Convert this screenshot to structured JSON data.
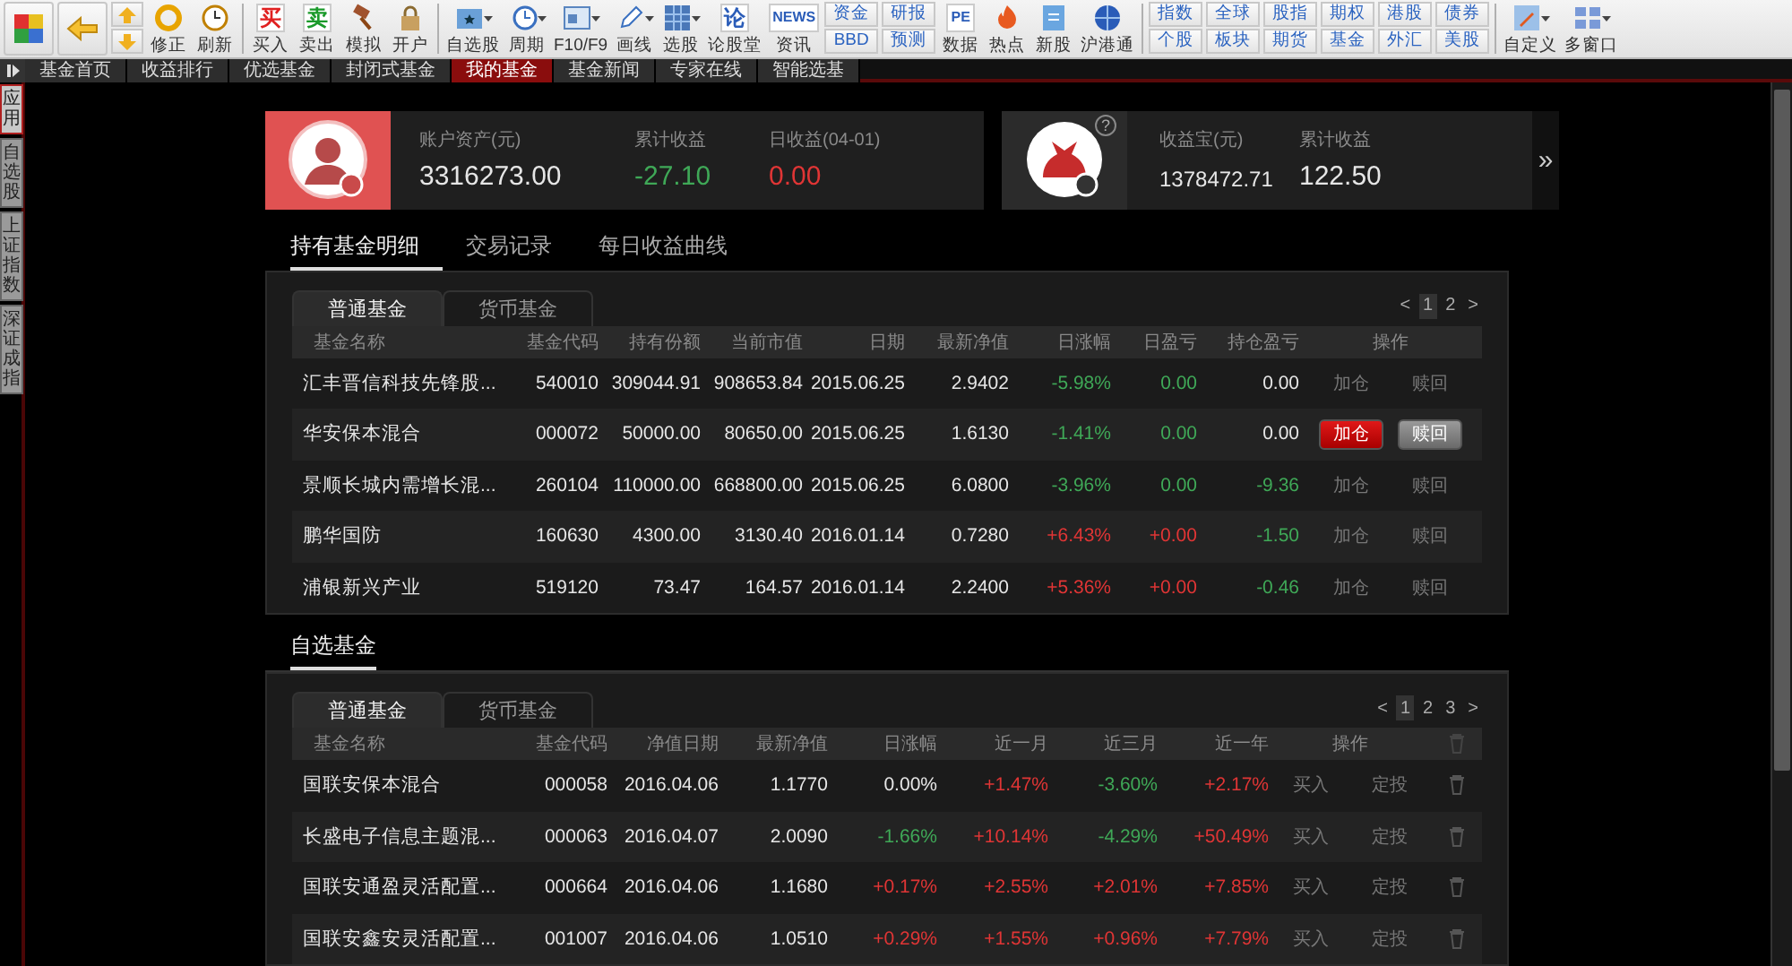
{
  "toolbar": [
    {
      "kind": "tool",
      "label": "修正",
      "dropdown": false
    },
    {
      "kind": "tool",
      "label": "刷新",
      "dropdown": false
    },
    {
      "kind": "separator"
    },
    {
      "kind": "tool",
      "label": "买入",
      "dropdown": false,
      "glyph": "买",
      "color": "#e02020"
    },
    {
      "kind": "tool",
      "label": "卖出",
      "dropdown": false,
      "glyph": "卖",
      "color": "#1a9a2a"
    },
    {
      "kind": "tool",
      "label": "模拟",
      "dropdown": false
    },
    {
      "kind": "tool",
      "label": "开户",
      "dropdown": false
    },
    {
      "kind": "separator"
    },
    {
      "kind": "tool",
      "label": "自选股",
      "dropdown": true
    },
    {
      "kind": "tool",
      "label": "周期",
      "dropdown": true
    },
    {
      "kind": "tool",
      "label": "F10/F9",
      "dropdown": true
    },
    {
      "kind": "tool",
      "label": "画线",
      "dropdown": true
    },
    {
      "kind": "tool",
      "label": "选股",
      "dropdown": true
    },
    {
      "kind": "tool",
      "label": "论股堂",
      "dropdown": false,
      "glyph": "论",
      "color": "#2a5cb8"
    },
    {
      "kind": "tool",
      "label": "资讯",
      "dropdown": false,
      "glyph": "NEWS",
      "color": "#2a5cb8"
    },
    {
      "kind": "pair",
      "top": "资金",
      "bottom": "BBD"
    },
    {
      "kind": "pair",
      "top": "研报",
      "bottom": "预测"
    },
    {
      "kind": "tool",
      "label": "数据",
      "dropdown": false,
      "glyph": "PE",
      "color": "#2a5cb8"
    },
    {
      "kind": "tool",
      "label": "热点",
      "dropdown": false
    },
    {
      "kind": "tool",
      "label": "新股",
      "dropdown": false
    },
    {
      "kind": "tool",
      "label": "沪港通",
      "dropdown": false
    },
    {
      "kind": "separator"
    },
    {
      "kind": "pair",
      "top": "指数",
      "bottom": "个股"
    },
    {
      "kind": "pair",
      "top": "全球",
      "bottom": "板块"
    },
    {
      "kind": "pair",
      "top": "股指",
      "bottom": "期货"
    },
    {
      "kind": "pair",
      "top": "期权",
      "bottom": "基金"
    },
    {
      "kind": "pair",
      "top": "港股",
      "bottom": "外汇"
    },
    {
      "kind": "pair",
      "top": "债券",
      "bottom": "美股"
    },
    {
      "kind": "separator"
    },
    {
      "kind": "tool",
      "label": "自定义",
      "dropdown": true
    },
    {
      "kind": "tool",
      "label": "多窗口",
      "dropdown": true
    }
  ],
  "tabs": [
    {
      "label": "基金首页",
      "selected": false
    },
    {
      "label": "收益排行",
      "selected": false
    },
    {
      "label": "优选基金",
      "selected": false
    },
    {
      "label": "封闭式基金",
      "selected": false
    },
    {
      "label": "我的基金",
      "selected": true
    },
    {
      "label": "基金新闻",
      "selected": false
    },
    {
      "label": "专家在线",
      "selected": false
    },
    {
      "label": "智能选基",
      "selected": false
    }
  ],
  "side_tabs": [
    {
      "label": "应用",
      "selected": true
    },
    {
      "label": "自选股",
      "selected": false
    },
    {
      "label": "上证指数",
      "selected": false
    },
    {
      "label": "深证成指",
      "selected": false
    }
  ],
  "account_card": {
    "fields": [
      {
        "label": "账户资产(元)",
        "value": "3316273.00"
      },
      {
        "label": "累计收益",
        "value": "-27.10",
        "color": "#3fa857"
      },
      {
        "label": "日收益(04-01)",
        "value": "0.00",
        "color": "#e03535"
      }
    ]
  },
  "yield_card": {
    "help": "?",
    "more": "»",
    "fields": [
      {
        "label": "收益宝(元)",
        "value": "1378472.71"
      },
      {
        "label": "累计收益",
        "value": "122.50"
      }
    ]
  },
  "section_tabs": [
    {
      "label": "持有基金明细",
      "selected": true
    },
    {
      "label": "交易记录",
      "selected": false
    },
    {
      "label": "每日收益曲线",
      "selected": false
    }
  ],
  "holdings": {
    "tabs": [
      {
        "label": "普通基金",
        "selected": true
      },
      {
        "label": "货币基金",
        "selected": false
      }
    ],
    "pager": {
      "prev": "<",
      "next": ">",
      "pages": [
        {
          "label": "1",
          "selected": true
        },
        {
          "label": "2",
          "selected": false
        }
      ]
    },
    "columns": [
      "基金名称",
      "基金代码",
      "持有份额",
      "当前市值",
      "日期",
      "最新净值",
      "日涨幅",
      "日盈亏",
      "持仓盈亏",
      "操作"
    ],
    "rows": [
      {
        "cells": [
          {
            "text": "汇丰晋信科技先锋股..."
          },
          {
            "text": "540010"
          },
          {
            "text": "309044.91"
          },
          {
            "text": "908653.84"
          },
          {
            "text": "2015.06.25"
          },
          {
            "text": "2.9402"
          },
          {
            "text": "-5.98%",
            "color": "#3fa857"
          },
          {
            "text": "0.00",
            "color": "#3fa857"
          },
          {
            "text": "0.00"
          }
        ],
        "actions": [
          "加仓",
          "赎回"
        ],
        "highlighted": false
      },
      {
        "cells": [
          {
            "text": "华安保本混合"
          },
          {
            "text": "000072"
          },
          {
            "text": "50000.00"
          },
          {
            "text": "80650.00"
          },
          {
            "text": "2015.06.25"
          },
          {
            "text": "1.6130"
          },
          {
            "text": "-1.41%",
            "color": "#3fa857"
          },
          {
            "text": "0.00",
            "color": "#3fa857"
          },
          {
            "text": "0.00"
          }
        ],
        "actions": [
          "加仓",
          "赎回"
        ],
        "highlighted": true
      },
      {
        "cells": [
          {
            "text": "景顺长城内需增长混..."
          },
          {
            "text": "260104"
          },
          {
            "text": "110000.00"
          },
          {
            "text": "668800.00"
          },
          {
            "text": "2015.06.25"
          },
          {
            "text": "6.0800"
          },
          {
            "text": "-3.96%",
            "color": "#3fa857"
          },
          {
            "text": "0.00",
            "color": "#3fa857"
          },
          {
            "text": "-9.36",
            "color": "#3fa857"
          }
        ],
        "actions": [
          "加仓",
          "赎回"
        ],
        "highlighted": false
      },
      {
        "cells": [
          {
            "text": "鹏华国防"
          },
          {
            "text": "160630"
          },
          {
            "text": "4300.00"
          },
          {
            "text": "3130.40"
          },
          {
            "text": "2016.01.14"
          },
          {
            "text": "0.7280"
          },
          {
            "text": "+6.43%",
            "color": "#e03535"
          },
          {
            "text": "+0.00",
            "color": "#e03535"
          },
          {
            "text": "-1.50",
            "color": "#3fa857"
          }
        ],
        "actions": [
          "加仓",
          "赎回"
        ],
        "highlighted": false
      },
      {
        "cells": [
          {
            "text": "浦银新兴产业"
          },
          {
            "text": "519120"
          },
          {
            "text": "73.47"
          },
          {
            "text": "164.57"
          },
          {
            "text": "2016.01.14"
          },
          {
            "text": "2.2400"
          },
          {
            "text": "+5.36%",
            "color": "#e03535"
          },
          {
            "text": "+0.00",
            "color": "#e03535"
          },
          {
            "text": "-0.46",
            "color": "#3fa857"
          }
        ],
        "actions": [
          "加仓",
          "赎回"
        ],
        "highlighted": false
      }
    ]
  },
  "watchlist_title": "自选基金",
  "watchlist": {
    "tabs": [
      {
        "label": "普通基金",
        "selected": true
      },
      {
        "label": "货币基金",
        "selected": false
      }
    ],
    "pager": {
      "prev": "<",
      "next": ">",
      "pages": [
        {
          "label": "1",
          "selected": true
        },
        {
          "label": "2",
          "selected": false
        },
        {
          "label": "3",
          "selected": false
        }
      ]
    },
    "columns": [
      "基金名称",
      "基金代码",
      "净值日期",
      "最新净值",
      "日涨幅",
      "近一月",
      "近三月",
      "近一年",
      "操作"
    ],
    "rows": [
      {
        "cells": [
          {
            "text": "国联安保本混合"
          },
          {
            "text": "000058"
          },
          {
            "text": "2016.04.06"
          },
          {
            "text": "1.1770"
          },
          {
            "text": "0.00%"
          },
          {
            "text": "+1.47%",
            "color": "#e03535"
          },
          {
            "text": "-3.60%",
            "color": "#3fa857"
          },
          {
            "text": "+2.17%",
            "color": "#e03535"
          }
        ],
        "actions": [
          "买入",
          "定投"
        ]
      },
      {
        "cells": [
          {
            "text": "长盛电子信息主题混..."
          },
          {
            "text": "000063"
          },
          {
            "text": "2016.04.07"
          },
          {
            "text": "2.0090"
          },
          {
            "text": "-1.66%",
            "color": "#3fa857"
          },
          {
            "text": "+10.14%",
            "color": "#e03535"
          },
          {
            "text": "-4.29%",
            "color": "#3fa857"
          },
          {
            "text": "+50.49%",
            "color": "#e03535"
          }
        ],
        "actions": [
          "买入",
          "定投"
        ]
      },
      {
        "cells": [
          {
            "text": "国联安通盈灵活配置..."
          },
          {
            "text": "000664"
          },
          {
            "text": "2016.04.06"
          },
          {
            "text": "1.1680"
          },
          {
            "text": "+0.17%",
            "color": "#e03535"
          },
          {
            "text": "+2.55%",
            "color": "#e03535"
          },
          {
            "text": "+2.01%",
            "color": "#e03535"
          },
          {
            "text": "+7.85%",
            "color": "#e03535"
          }
        ],
        "actions": [
          "买入",
          "定投"
        ]
      },
      {
        "cells": [
          {
            "text": "国联安鑫安灵活配置..."
          },
          {
            "text": "001007"
          },
          {
            "text": "2016.04.06"
          },
          {
            "text": "1.0510"
          },
          {
            "text": "+0.29%",
            "color": "#e03535"
          },
          {
            "text": "+1.55%",
            "color": "#e03535"
          },
          {
            "text": "+0.96%",
            "color": "#e03535"
          },
          {
            "text": "+7.79%",
            "color": "#e03535"
          }
        ],
        "actions": [
          "买入",
          "定投"
        ]
      }
    ]
  }
}
